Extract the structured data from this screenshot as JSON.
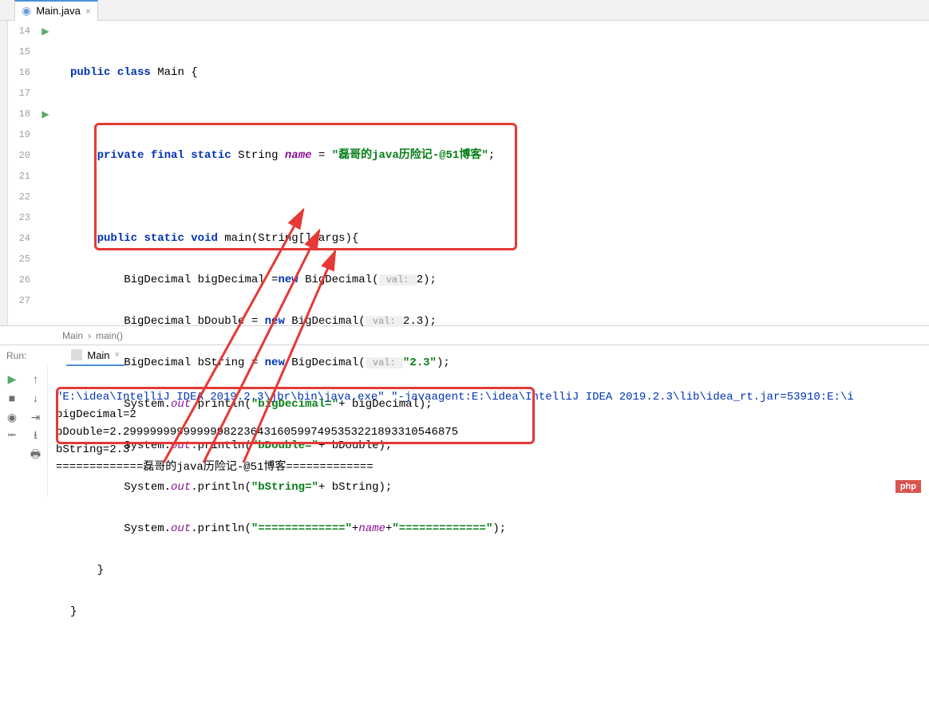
{
  "tab": {
    "filename": "Main.java",
    "close": "×"
  },
  "gutter": {
    "lines": [
      "14",
      "15",
      "16",
      "17",
      "18",
      "19",
      "20",
      "21",
      "22",
      "23",
      "24",
      "25",
      "26",
      "27"
    ]
  },
  "code": {
    "l14": {
      "public": "public",
      "class": "class",
      "name": " Main {"
    },
    "l16": {
      "private": "private",
      "final": "final",
      "static": "static",
      "type": " String ",
      "var": "name",
      "eq": " = ",
      "str": "\"磊哥的java历险记-@51博客\"",
      "semi": ";"
    },
    "l18": {
      "public": "public",
      "static": "static",
      "void": "void",
      "sig": " main(String[] args){"
    },
    "l19": {
      "pre": "BigDecimal bigDecimal =",
      "new": "new",
      "ctor": " BigDecimal(",
      "hint": " val: ",
      "arg": "2",
      "end": ");"
    },
    "l20": {
      "pre": "BigDecimal bDouble = ",
      "new": "new",
      "ctor": " BigDecimal(",
      "hint": " val: ",
      "arg": "2.3",
      "end": ");"
    },
    "l21": {
      "pre": "BigDecimal bString = ",
      "new": "new",
      "ctor": " BigDecimal(",
      "hint": " val: ",
      "arg": "\"2.3\"",
      "end": ");"
    },
    "l22": {
      "pre": "System.",
      "out": "out",
      "call": ".println(",
      "str": "\"bigDecimal=\"",
      "rest": "+ bigDecimal);"
    },
    "l23": {
      "pre": "System.",
      "out": "out",
      "call": ".println(",
      "str": "\"bDouble=\"",
      "rest": "+ bDouble);"
    },
    "l24": {
      "pre": "System.",
      "out": "out",
      "call": ".println(",
      "str": "\"bString=\"",
      "rest": "+ bString);"
    },
    "l25": {
      "pre": "System.",
      "out": "out",
      "call": ".println(",
      "str1": "\"=============\"",
      "plus1": "+",
      "name": "name",
      "plus2": "+",
      "str2": "\"=============\"",
      "end": ");"
    },
    "l26": "    }",
    "l27": "}"
  },
  "breadcrumb": {
    "a": "Main",
    "sep": "›",
    "b": "main()"
  },
  "run": {
    "label": "Run:",
    "tab": "Main",
    "tabclose": "×",
    "line1": "\"E:\\idea\\IntelliJ IDEA 2019.2.3\\jbr\\bin\\java.exe\" \"-javaagent:E:\\idea\\IntelliJ IDEA 2019.2.3\\lib\\idea_rt.jar=53910:E:\\i",
    "line2": "bigDecimal=2",
    "line3": "bDouble=2.29999999999999982236431605997495353221893310546875",
    "line4": "bString=2.3",
    "line5": "=============磊哥的java历险记-@51博客============="
  },
  "watermark": "php"
}
